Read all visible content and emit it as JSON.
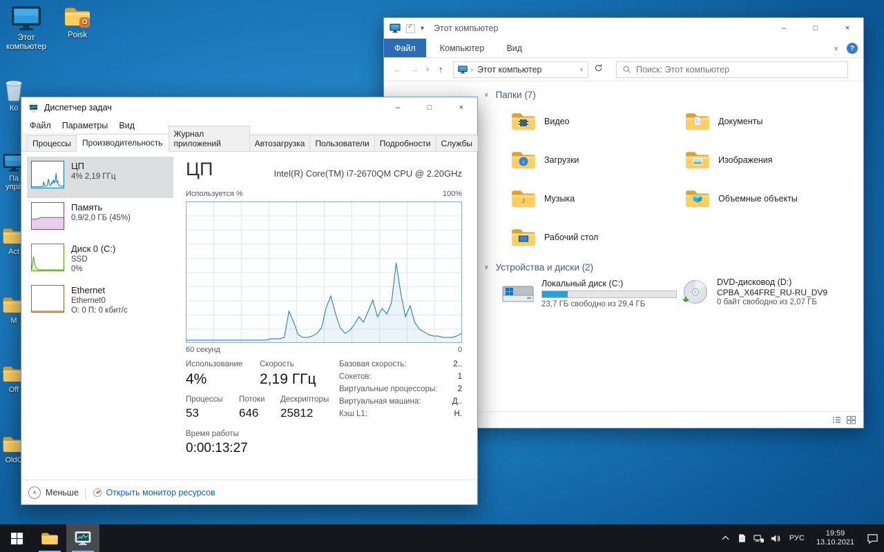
{
  "desktop": {
    "icon_computer": "Этот компьютер",
    "icon_poisk": "Poisk",
    "edge_labels": [
      "Ко",
      "Па упра",
      "Act",
      "M",
      "Off",
      "OldC"
    ]
  },
  "explorer": {
    "window_title": "Этот компьютер",
    "ribbon": {
      "file": "Файл",
      "computer": "Компьютер",
      "view": "Вид"
    },
    "address": "Этот компьютер",
    "search_placeholder": "Поиск: Этот компьютер",
    "groups": {
      "folders": "Папки (7)",
      "devices": "Устройства и диски (2)"
    },
    "folders": [
      "Видео",
      "Документы",
      "Загрузки",
      "Изображения",
      "Музыка",
      "Объемные объекты",
      "Рабочий стол"
    ],
    "drive_c": {
      "label": "Локальный диск (C:)",
      "free_text": "23,7 ГБ свободно из 29,4 ГБ",
      "used_pct": 19
    },
    "drive_d": {
      "label": "DVD-дисковод (D:)",
      "volume": "CPBA_X64FRE_RU-RU_DV9",
      "free_text": "0 байт свободно из 2,07 ГБ"
    }
  },
  "taskmanager": {
    "title": "Диспетчер задач",
    "menu": [
      "Файл",
      "Параметры",
      "Вид"
    ],
    "tabs": [
      "Процессы",
      "Производительность",
      "Журнал приложений",
      "Автозагрузка",
      "Пользователи",
      "Подробности",
      "Службы"
    ],
    "active_tab": "Производительность",
    "sidebar": [
      {
        "name": "ЦП",
        "line2": "4% 2,19 ГГц"
      },
      {
        "name": "Память",
        "line2": "0,9/2,0 ГБ (45%)"
      },
      {
        "name": "Диск 0 (C:)",
        "line2": "SSD",
        "line3": "0%"
      },
      {
        "name": "Ethernet",
        "line2": "Ethernet0",
        "line3": "О: 0 П: 0 кбит/с"
      }
    ],
    "cpu_panel": {
      "heading": "ЦП",
      "cpu_name": "Intel(R) Core(TM) i7-2670QM CPU @ 2.20GHz",
      "y_axis_label": "Используется %",
      "y_axis_max": "100%",
      "x_axis_left": "60 секунд",
      "x_axis_right": "0",
      "usage_label": "Использование",
      "usage_value": "4%",
      "speed_label": "Скорость",
      "speed_value": "2,19 ГГц",
      "processes_label": "Процессы",
      "processes_value": "53",
      "threads_label": "Потоки",
      "threads_value": "646",
      "handles_label": "Дескрипторы",
      "handles_value": "25812",
      "uptime_label": "Время работы",
      "uptime_value": "0:00:13:27",
      "right_stats": [
        {
          "label": "Базовая скорость:",
          "value": "2.."
        },
        {
          "label": "Сокетов:",
          "value": "1"
        },
        {
          "label": "Виртуальные процессоры:",
          "value": "2"
        },
        {
          "label": "Виртуальная машина:",
          "value": "Д.."
        },
        {
          "label": "Кэш L1:",
          "value": "Н."
        }
      ]
    },
    "footer": {
      "less": "Меньше",
      "resmon_link": "Открыть монитор ресурсов"
    }
  },
  "taskbar": {
    "lang": "РУС",
    "time": "19:59",
    "date": "13.10.2021"
  },
  "glyphs": {
    "minimize": "–",
    "maximize": "□",
    "close": "×",
    "chevron_down": "∨",
    "chevron_up": "∧",
    "back_arrow": "←",
    "forward_arrow": "→",
    "up_arrow": "↑",
    "breadcrumb_sep": "›",
    "qat_dropdown": "▾",
    "check": "✓",
    "music_note": "♪",
    "down_arrow": "↓",
    "help": "?"
  },
  "colors": {
    "cpu_blue": "#1177bb",
    "memory_purple": "#9b3fa5",
    "disk_green": "#4da30a",
    "net_brown": "#a1642c",
    "file_tab_blue": "#2b6cb5",
    "drive_bar_blue": "#26a0da",
    "link_blue": "#0066cc",
    "group_header_blue": "#3c5a96",
    "selection_gray": "#dcdedf"
  },
  "chart_data": {
    "type": "line",
    "title": "ЦП — Используется %",
    "ylabel": "Используется %",
    "ylim": [
      0,
      100
    ],
    "x_axis": {
      "left": "60 секунд",
      "right": "0"
    },
    "grid": true,
    "cpu_percent": [
      1,
      1,
      1,
      1,
      1,
      1,
      1,
      1,
      1,
      1,
      1,
      1,
      1,
      1,
      1,
      1,
      1,
      1,
      2,
      2,
      2,
      3,
      22,
      14,
      5,
      3,
      3,
      4,
      6,
      10,
      25,
      33,
      20,
      10,
      6,
      8,
      12,
      18,
      14,
      22,
      30,
      18,
      24,
      20,
      28,
      57,
      35,
      18,
      26,
      14,
      9,
      7,
      5,
      4,
      4,
      3,
      3,
      3,
      4,
      6
    ],
    "memory_thumb_pct": [
      38,
      38,
      39,
      39,
      40,
      45,
      45,
      45,
      45,
      45,
      45,
      45,
      45,
      45,
      45,
      45,
      45,
      45,
      45,
      45
    ],
    "disk_thumb_pct": [
      2,
      55,
      18,
      4,
      1,
      0,
      0,
      0,
      0,
      0,
      0,
      0,
      1,
      0,
      0,
      0,
      0,
      0,
      0,
      0
    ],
    "net_thumb_pct": [
      0,
      0,
      0,
      0,
      0,
      0,
      0,
      0,
      0,
      0,
      0,
      0,
      0,
      0,
      0,
      0,
      0,
      0,
      0,
      0
    ]
  }
}
